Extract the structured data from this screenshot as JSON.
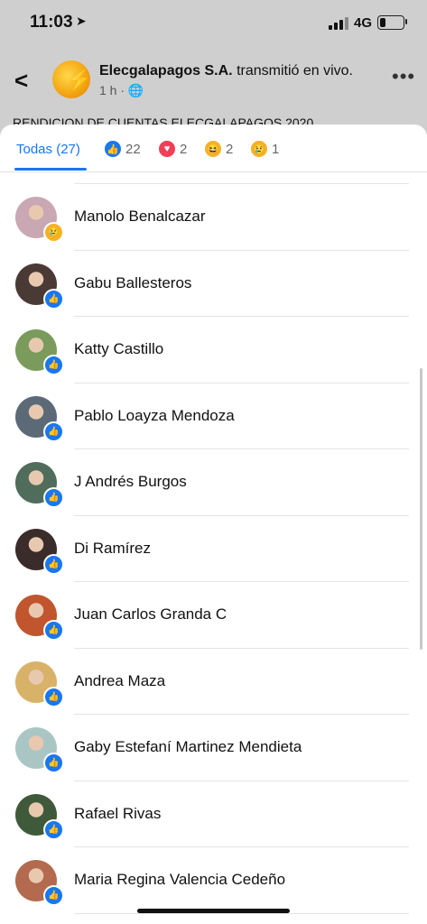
{
  "status_bar": {
    "time": "11:03",
    "network": "4G"
  },
  "post": {
    "page_name": "Elecgalapagos S.A.",
    "action": "transmitió en vivo.",
    "time_ago": "1 h ·",
    "text": "RENDICION DE CUENTAS ELECGALAPAGOS 2020"
  },
  "tabs": [
    {
      "label": "Todas (27)",
      "icon": ""
    },
    {
      "label": "22",
      "icon": "like-icon"
    },
    {
      "label": "2",
      "icon": "love-icon"
    },
    {
      "label": "2",
      "icon": "haha-icon"
    },
    {
      "label": "1",
      "icon": "sad-icon"
    }
  ],
  "people": [
    {
      "name": "Manolo Benalcazar",
      "reaction": "sad",
      "avatar_color": "#c9a7b3"
    },
    {
      "name": "Gabu Ballesteros",
      "reaction": "like",
      "avatar_color": "#4a3a36"
    },
    {
      "name": "Katty Castillo",
      "reaction": "like",
      "avatar_color": "#7a9b5c"
    },
    {
      "name": "Pablo Loayza Mendoza",
      "reaction": "like",
      "avatar_color": "#5c6a78"
    },
    {
      "name": "J Andrés Burgos",
      "reaction": "like",
      "avatar_color": "#4f6d5a"
    },
    {
      "name": "Di Ramírez",
      "reaction": "like",
      "avatar_color": "#3a2c2a"
    },
    {
      "name": "Juan Carlos Granda C",
      "reaction": "like",
      "avatar_color": "#c0552e"
    },
    {
      "name": "Andrea Maza",
      "reaction": "like",
      "avatar_color": "#d9b26a"
    },
    {
      "name": "Gaby Estefaní Martinez Mendieta",
      "reaction": "like",
      "avatar_color": "#a9c6c4"
    },
    {
      "name": "Rafael Rivas",
      "reaction": "like",
      "avatar_color": "#3f5a3a"
    },
    {
      "name": "Maria Regina Valencia Cedeño",
      "reaction": "like",
      "avatar_color": "#b36a4f"
    }
  ],
  "colors": {
    "accent": "#1877f2",
    "like": "#1877f2",
    "love": "#f33e58",
    "haha": "#f7b125",
    "sad": "#f7b125"
  }
}
